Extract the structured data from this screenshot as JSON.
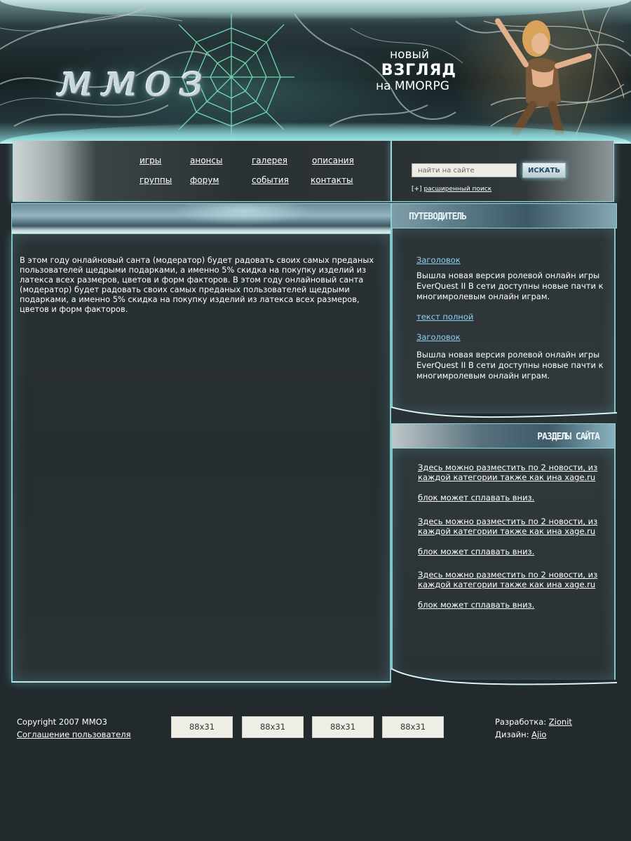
{
  "header": {
    "logo_text": "ммоз",
    "slogan": {
      "line1": "новый",
      "line2": "ВЗГЛЯД",
      "line3": "на MMORPG"
    }
  },
  "nav": {
    "items": [
      "игры",
      "анонсы",
      "галерея",
      "описания",
      "группы",
      "форум",
      "события",
      "контакты"
    ]
  },
  "search": {
    "placeholder": "найти на сайте",
    "button_label": "ИСКАТЬ",
    "advanced_prefix": "[+]",
    "advanced_label": "расширенный поиск"
  },
  "main": {
    "text": "В этом году онлайновый санта (модератор) будет радовать своих самых преданых пользователей щедрыми подарками, а именно 5% скидка на покупку изделий из латекса всех размеров, цветов и форм факторов. В этом году онлайновый санта (модератор) будет радовать своих самых преданых пользователей щедрыми подарками, а именно 5% скидка на покупку изделий из латекса всех размеров, цветов и форм факторов."
  },
  "guide": {
    "title": "ПУТЕВОДИТЕЛЬ",
    "heading1": "Заголовок",
    "text1": "Вышла новая версия ролевой онлайн игры EverQuest II В сети доступны новые пачти к многимролевым онлайн играм.",
    "more_link": "текст полной",
    "heading2": "Заголовок",
    "text2": "Вышла новая версия ролевой онлайн игры EverQuest II В сети доступны новые пачти к многимролевым онлайн играм."
  },
  "sections": {
    "title": "РАЗДЕЛЫ САЙТА",
    "items": [
      "Здесь можно разместить по 2 новости, из каждой категории также как ина xage.ru",
      "блок может сплавать вниз.",
      "Здесь можно разместить по 2 новости, из каждой категории также как ина xage.ru",
      "блок может сплавать вниз.",
      "Здесь можно разместить по 2 новости, из каждой категории также как ина xage.ru",
      "блок может сплавать вниз."
    ]
  },
  "footer": {
    "copyright": "Copyright 2007 MMO3",
    "agreement_link": "Соглашение пользователя",
    "banners": [
      "88x31",
      "88x31",
      "88x31",
      "88x31"
    ],
    "dev_label": "Разработка:",
    "dev_link": "Zionit",
    "design_label": "Дизайн:",
    "design_link": "Ajio"
  },
  "colors": {
    "page_bg": "#222a2d",
    "glow": "#7ec6ca",
    "link_blue": "#8fd0f2"
  }
}
